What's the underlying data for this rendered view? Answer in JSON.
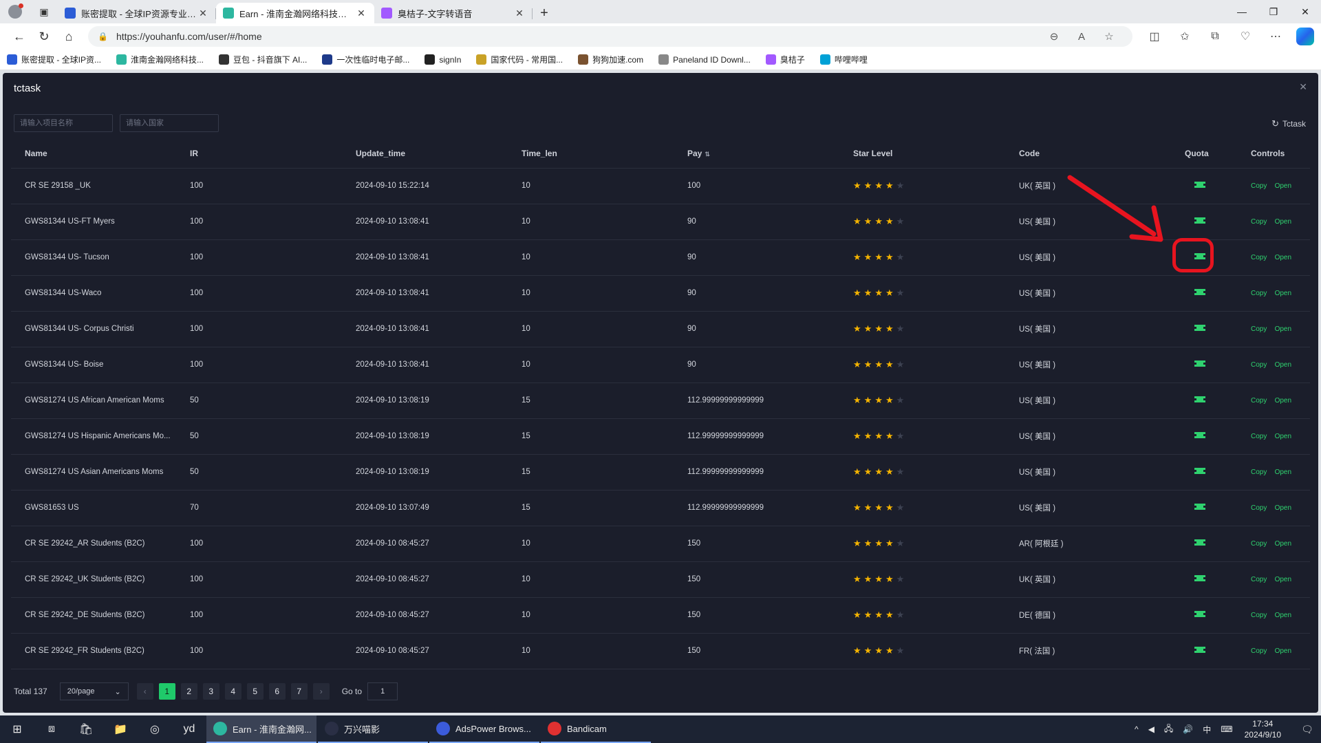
{
  "browser": {
    "tabs": [
      {
        "title": "账密提取 - 全球IP资源专业服务商",
        "color": "#2b5cd6",
        "active": false
      },
      {
        "title": "Earn - 淮南金瀚网络科技有限公司",
        "color": "#2db7a0",
        "active": true
      },
      {
        "title": "臭桔子-文字转语音",
        "color": "#a259ff",
        "active": false
      }
    ],
    "url": "https://youhanfu.com/user/#/home",
    "bookmarks": [
      {
        "label": "账密提取 - 全球IP资...",
        "color": "#2b5cd6"
      },
      {
        "label": "淮南金瀚网络科技...",
        "color": "#2db7a0"
      },
      {
        "label": "豆包 - 抖音旗下 AI...",
        "color": "#333333"
      },
      {
        "label": "一次性临时电子邮...",
        "color": "#1e3a8a"
      },
      {
        "label": "signIn",
        "color": "#222222"
      },
      {
        "label": "国家代码 - 常用国...",
        "color": "#c9a227"
      },
      {
        "label": "狗狗加速.com",
        "color": "#7a5230"
      },
      {
        "label": "Paneland ID Downl...",
        "color": "#888888"
      },
      {
        "label": "臭桔子",
        "color": "#a259ff"
      },
      {
        "label": "哔哩哔哩",
        "color": "#00a1d6"
      }
    ]
  },
  "modal": {
    "title": "tctask",
    "filter_name_placeholder": "请输入项目名称",
    "filter_country_placeholder": "请输入国家",
    "refresh_label": "Tctask",
    "columns": {
      "name": "Name",
      "ir": "IR",
      "update_time": "Update_time",
      "time_len": "Time_len",
      "pay": "Pay",
      "star_level": "Star Level",
      "code": "Code",
      "quota": "Quota",
      "controls": "Controls"
    },
    "copy_label": "Copy",
    "open_label": "Open",
    "rows": [
      {
        "name": "CR SE 29158 _UK",
        "ir": "100",
        "update_time": "2024-09-10 15:22:14",
        "time_len": "10",
        "pay": "100",
        "stars": 4,
        "code": "UK( 英国 )"
      },
      {
        "name": "GWS81344 US-FT Myers",
        "ir": "100",
        "update_time": "2024-09-10 13:08:41",
        "time_len": "10",
        "pay": "90",
        "stars": 4,
        "code": "US( 美国 )"
      },
      {
        "name": "GWS81344 US- Tucson",
        "ir": "100",
        "update_time": "2024-09-10 13:08:41",
        "time_len": "10",
        "pay": "90",
        "stars": 4,
        "code": "US( 美国 )"
      },
      {
        "name": "GWS81344 US-Waco",
        "ir": "100",
        "update_time": "2024-09-10 13:08:41",
        "time_len": "10",
        "pay": "90",
        "stars": 4,
        "code": "US( 美国 )"
      },
      {
        "name": "GWS81344 US- Corpus Christi",
        "ir": "100",
        "update_time": "2024-09-10 13:08:41",
        "time_len": "10",
        "pay": "90",
        "stars": 4,
        "code": "US( 美国 )"
      },
      {
        "name": "GWS81344 US- Boise",
        "ir": "100",
        "update_time": "2024-09-10 13:08:41",
        "time_len": "10",
        "pay": "90",
        "stars": 4,
        "code": "US( 美国 )"
      },
      {
        "name": "GWS81274 US African American Moms",
        "ir": "50",
        "update_time": "2024-09-10 13:08:19",
        "time_len": "15",
        "pay": "112.99999999999999",
        "stars": 4,
        "code": "US( 美国 )"
      },
      {
        "name": "GWS81274 US Hispanic Americans Mo...",
        "ir": "50",
        "update_time": "2024-09-10 13:08:19",
        "time_len": "15",
        "pay": "112.99999999999999",
        "stars": 4,
        "code": "US( 美国 )"
      },
      {
        "name": "GWS81274 US Asian Americans Moms",
        "ir": "50",
        "update_time": "2024-09-10 13:08:19",
        "time_len": "15",
        "pay": "112.99999999999999",
        "stars": 4,
        "code": "US( 美国 )"
      },
      {
        "name": "GWS81653 US",
        "ir": "70",
        "update_time": "2024-09-10 13:07:49",
        "time_len": "15",
        "pay": "112.99999999999999",
        "stars": 4,
        "code": "US( 美国 )"
      },
      {
        "name": "CR SE 29242_AR Students (B2C)",
        "ir": "100",
        "update_time": "2024-09-10 08:45:27",
        "time_len": "10",
        "pay": "150",
        "stars": 4,
        "code": "AR( 阿根廷 )"
      },
      {
        "name": "CR SE 29242_UK Students (B2C)",
        "ir": "100",
        "update_time": "2024-09-10 08:45:27",
        "time_len": "10",
        "pay": "150",
        "stars": 4,
        "code": "UK( 英国 )"
      },
      {
        "name": "CR SE 29242_DE Students (B2C)",
        "ir": "100",
        "update_time": "2024-09-10 08:45:27",
        "time_len": "10",
        "pay": "150",
        "stars": 4,
        "code": "DE( 德国 )"
      },
      {
        "name": "CR SE 29242_FR Students (B2C)",
        "ir": "100",
        "update_time": "2024-09-10 08:45:27",
        "time_len": "10",
        "pay": "150",
        "stars": 4,
        "code": "FR( 法国 )"
      }
    ],
    "pagination": {
      "total": "Total 137",
      "page_size": "20/page",
      "pages": [
        "1",
        "2",
        "3",
        "4",
        "5",
        "6",
        "7"
      ],
      "current": "1",
      "goto_label": "Go to",
      "goto_value": "1"
    }
  },
  "taskbar": {
    "apps": [
      {
        "label": "Earn - 淮南金瀚网...",
        "color": "#2db7a0",
        "active": true
      },
      {
        "label": "万兴喵影",
        "color": "#2a2f45",
        "active": false
      },
      {
        "label": "AdsPower Brows...",
        "color": "#3b5bdb",
        "active": false
      },
      {
        "label": "Bandicam",
        "color": "#e03131",
        "active": false
      }
    ],
    "ime": "中",
    "time": "17:34",
    "date": "2024/9/10"
  }
}
